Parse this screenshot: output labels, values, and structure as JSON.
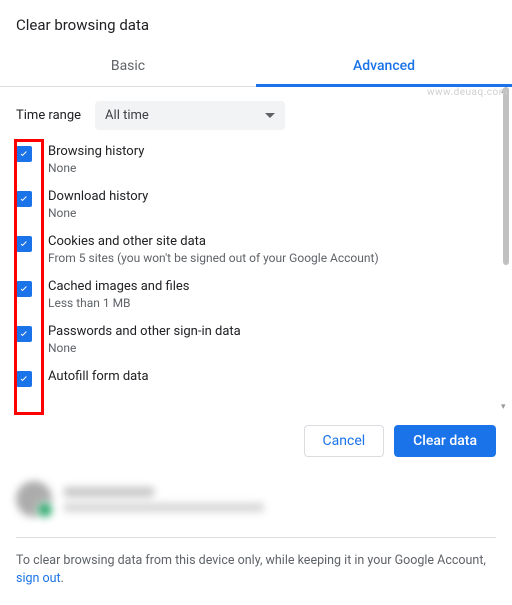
{
  "dialog": {
    "title": "Clear browsing data",
    "tabs": {
      "basic": "Basic",
      "advanced": "Advanced",
      "active": "advanced"
    },
    "time_range": {
      "label": "Time range",
      "value": "All time"
    },
    "items": [
      {
        "title": "Browsing history",
        "sub": "None",
        "checked": true
      },
      {
        "title": "Download history",
        "sub": "None",
        "checked": true
      },
      {
        "title": "Cookies and other site data",
        "sub": "From 5 sites (you won't be signed out of your Google Account)",
        "checked": true
      },
      {
        "title": "Cached images and files",
        "sub": "Less than 1 MB",
        "checked": true
      },
      {
        "title": "Passwords and other sign-in data",
        "sub": "None",
        "checked": true
      },
      {
        "title": "Autofill form data",
        "sub": "",
        "checked": true
      }
    ],
    "actions": {
      "cancel": "Cancel",
      "confirm": "Clear data"
    },
    "footer": {
      "text_before": "To clear browsing data from this device only, while keeping it in your Google Account, ",
      "link": "sign out",
      "text_after": "."
    }
  },
  "watermark": "www.deuaq.com"
}
